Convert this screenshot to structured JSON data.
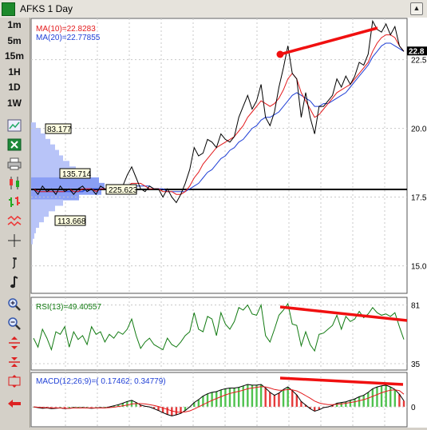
{
  "window": {
    "title": "AFKS 1 Day",
    "scroll_up_glyph": "▲"
  },
  "toolbar": {
    "timeframes": [
      "1m",
      "5m",
      "15m",
      "1H",
      "1D",
      "1W"
    ],
    "tools": [
      "chart-bars-icon",
      "excel-export-icon",
      "print-icon",
      "candle-chart-icon",
      "bar-chart-icon",
      "wave-icon",
      "crosshair-icon",
      "line-draw-icon",
      "note-icon",
      "zoom-in-icon",
      "zoom-out-icon",
      "expand-vertical-icon",
      "compress-vertical-icon",
      "fit-vertical-icon",
      "back-arrow-icon"
    ]
  },
  "colors": {
    "price": "#000000",
    "ma10": "#e31a1c",
    "ma20": "#1f3fd6",
    "rsi": "#117a11",
    "trend": "#f01010",
    "profile": "#b8c4f8",
    "profile_dark": "#8a9ff5",
    "hist_up": "#4ec24e",
    "hist_down": "#e53a3a",
    "level": "#000000"
  },
  "price_panel": {
    "legend": {
      "ma10": "MA(10)=22.8283",
      "ma20": "MA(20)=22.77855"
    },
    "current_price_label": "22.8",
    "axis_ticks": [
      {
        "label": "22.5",
        "value": 22.5
      },
      {
        "label": "20.0",
        "value": 20.0
      },
      {
        "label": "17.5",
        "value": 17.5
      },
      {
        "label": "15.0",
        "value": 15.0
      }
    ],
    "volume_labels": [
      "83.177",
      "135.714",
      "113.668"
    ],
    "level_label": "225.623",
    "level_value": 17.78
  },
  "rsi_panel": {
    "label": "RSI(13)=49.40557",
    "axis_ticks": [
      {
        "label": "81",
        "value": 81
      },
      {
        "label": "35",
        "value": 35
      }
    ]
  },
  "macd_panel": {
    "label": "MACD(12;26;9)=( 0.17462; 0.34779)",
    "axis_ticks": [
      {
        "label": "0",
        "value": 0
      }
    ]
  },
  "chart_data": {
    "type": "line",
    "title": "AFKS 1 Day",
    "x_count": 84,
    "ylim": [
      14.0,
      24.0
    ],
    "series": [
      {
        "name": "Price",
        "values": [
          17.8,
          17.6,
          17.9,
          17.7,
          17.8,
          17.6,
          17.9,
          17.7,
          17.8,
          17.6,
          17.8,
          17.9,
          17.7,
          17.8,
          17.6,
          17.9,
          17.8,
          17.7,
          17.8,
          17.9,
          17.9,
          18.3,
          18.6,
          18.2,
          17.8,
          17.7,
          17.9,
          17.8,
          17.8,
          17.5,
          17.8,
          17.5,
          17.3,
          17.6,
          18.0,
          18.5,
          19.3,
          19.0,
          19.1,
          19.6,
          19.5,
          19.3,
          19.8,
          19.6,
          19.5,
          19.7,
          20.4,
          20.8,
          21.2,
          20.7,
          21.0,
          21.6,
          20.4,
          20.1,
          20.6,
          21.5,
          22.2,
          23.0,
          22.0,
          21.8,
          20.4,
          21.3,
          20.4,
          19.8,
          20.8,
          20.8,
          21.0,
          21.2,
          21.8,
          21.5,
          21.9,
          21.6,
          21.9,
          22.4,
          22.3,
          22.7,
          23.9,
          23.6,
          23.5,
          23.8,
          23.4,
          23.7,
          23.0,
          22.8
        ]
      },
      {
        "name": "MA(10)",
        "values": [
          17.8,
          17.7,
          17.7,
          17.7,
          17.7,
          17.7,
          17.7,
          17.7,
          17.8,
          17.7,
          17.7,
          17.8,
          17.8,
          17.8,
          17.7,
          17.8,
          17.8,
          17.8,
          17.8,
          17.8,
          17.8,
          17.9,
          18.0,
          18.0,
          18.0,
          17.9,
          17.8,
          17.8,
          17.8,
          17.7,
          17.7,
          17.7,
          17.6,
          17.6,
          17.7,
          17.9,
          18.2,
          18.4,
          18.7,
          18.9,
          19.1,
          19.3,
          19.4,
          19.5,
          19.6,
          19.7,
          19.9,
          20.1,
          20.4,
          20.6,
          20.8,
          21.0,
          20.9,
          20.8,
          20.9,
          21.1,
          21.4,
          21.8,
          22.0,
          21.8,
          21.3,
          21.0,
          20.7,
          20.4,
          20.5,
          20.7,
          20.9,
          21.1,
          21.3,
          21.4,
          21.5,
          21.6,
          21.8,
          22.0,
          22.2,
          22.4,
          22.8,
          23.1,
          23.3,
          23.4,
          23.4,
          23.3,
          23.0,
          22.8
        ]
      },
      {
        "name": "MA(20)",
        "values": [
          17.8,
          17.7,
          17.7,
          17.7,
          17.7,
          17.7,
          17.7,
          17.7,
          17.7,
          17.7,
          17.7,
          17.7,
          17.8,
          17.8,
          17.8,
          17.8,
          17.8,
          17.8,
          17.8,
          17.8,
          17.8,
          17.8,
          17.9,
          17.9,
          17.9,
          17.9,
          17.9,
          17.8,
          17.8,
          17.8,
          17.7,
          17.7,
          17.7,
          17.7,
          17.7,
          17.8,
          17.9,
          18.0,
          18.2,
          18.4,
          18.5,
          18.7,
          18.9,
          19.0,
          19.2,
          19.3,
          19.5,
          19.6,
          19.8,
          20.0,
          20.1,
          20.3,
          20.4,
          20.4,
          20.5,
          20.6,
          20.8,
          21.0,
          21.2,
          21.3,
          21.2,
          21.1,
          21.0,
          20.8,
          20.8,
          20.9,
          20.9,
          21.0,
          21.1,
          21.2,
          21.3,
          21.5,
          21.7,
          21.9,
          22.1,
          22.3,
          22.6,
          22.8,
          23.0,
          23.1,
          23.1,
          23.0,
          22.9,
          22.8
        ]
      }
    ],
    "rsi_ylim": [
      30,
      87
    ],
    "rsi_values": [
      55,
      48,
      62,
      55,
      46,
      60,
      58,
      64,
      48,
      60,
      54,
      57,
      50,
      64,
      58,
      60,
      52,
      58,
      55,
      60,
      58,
      62,
      70,
      57,
      47,
      52,
      55,
      50,
      48,
      46,
      55,
      50,
      48,
      52,
      57,
      60,
      75,
      62,
      60,
      72,
      70,
      57,
      75,
      66,
      62,
      68,
      79,
      77,
      81,
      74,
      73,
      81,
      57,
      52,
      62,
      73,
      77,
      82,
      66,
      65,
      49,
      60,
      50,
      45,
      58,
      59,
      62,
      65,
      73,
      62,
      72,
      68,
      70,
      76,
      71,
      74,
      79,
      75,
      73,
      74,
      72,
      75,
      64,
      54
    ],
    "macd_ylim": [
      -0.55,
      0.95
    ],
    "macd_values": [
      0.0,
      -0.02,
      -0.04,
      -0.03,
      -0.05,
      -0.04,
      -0.03,
      -0.05,
      -0.04,
      -0.02,
      -0.03,
      -0.02,
      -0.03,
      -0.04,
      -0.03,
      -0.02,
      -0.03,
      0.0,
      0.03,
      0.06,
      0.1,
      0.15,
      0.18,
      0.12,
      0.05,
      0.02,
      0.0,
      -0.05,
      -0.1,
      -0.16,
      -0.21,
      -0.25,
      -0.22,
      -0.18,
      -0.1,
      0.0,
      0.12,
      0.2,
      0.3,
      0.36,
      0.4,
      0.42,
      0.47,
      0.5,
      0.52,
      0.52,
      0.54,
      0.58,
      0.62,
      0.6,
      0.6,
      0.62,
      0.52,
      0.4,
      0.32,
      0.38,
      0.48,
      0.55,
      0.45,
      0.33,
      0.15,
      0.05,
      -0.05,
      -0.12,
      -0.08,
      -0.02,
      0.0,
      0.04,
      0.1,
      0.12,
      0.14,
      0.18,
      0.22,
      0.28,
      0.32,
      0.4,
      0.5,
      0.55,
      0.58,
      0.6,
      0.55,
      0.48,
      0.35,
      0.17
    ],
    "signal_values": [
      0.0,
      -0.01,
      -0.02,
      -0.02,
      -0.03,
      -0.03,
      -0.03,
      -0.04,
      -0.04,
      -0.03,
      -0.03,
      -0.03,
      -0.03,
      -0.03,
      -0.03,
      -0.03,
      -0.03,
      -0.02,
      -0.01,
      0.01,
      0.03,
      0.05,
      0.08,
      0.09,
      0.09,
      0.08,
      0.06,
      0.04,
      0.01,
      -0.03,
      -0.07,
      -0.11,
      -0.14,
      -0.15,
      -0.14,
      -0.11,
      -0.06,
      0.0,
      0.06,
      0.12,
      0.18,
      0.23,
      0.28,
      0.33,
      0.37,
      0.4,
      0.43,
      0.46,
      0.5,
      0.52,
      0.54,
      0.56,
      0.55,
      0.52,
      0.48,
      0.46,
      0.46,
      0.48,
      0.47,
      0.44,
      0.38,
      0.31,
      0.24,
      0.16,
      0.11,
      0.08,
      0.06,
      0.06,
      0.07,
      0.08,
      0.1,
      0.12,
      0.14,
      0.17,
      0.2,
      0.24,
      0.29,
      0.34,
      0.39,
      0.43,
      0.46,
      0.47,
      0.45,
      0.35
    ]
  }
}
